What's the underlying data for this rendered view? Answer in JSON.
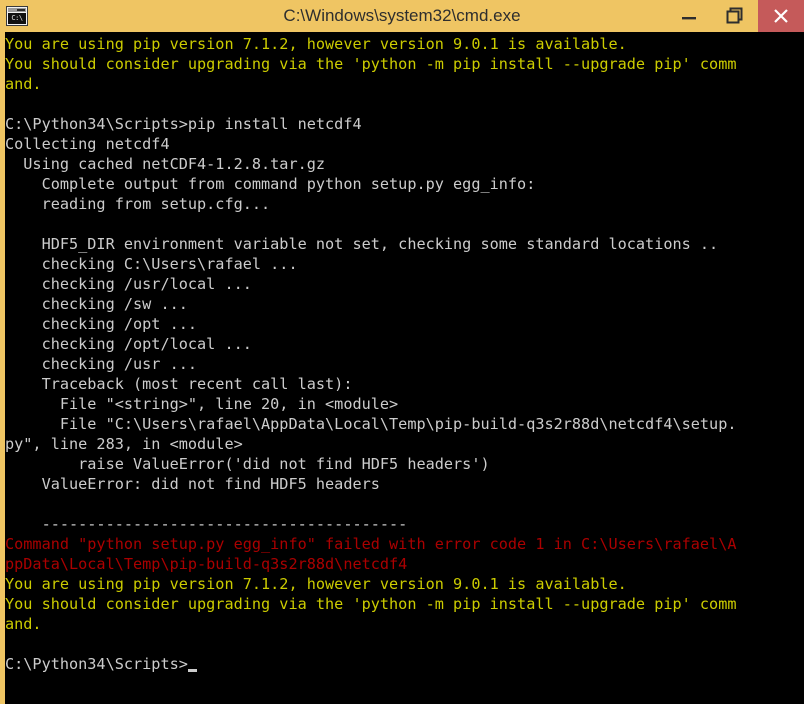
{
  "window": {
    "title": "C:\\Windows\\system32\\cmd.exe",
    "icon_name": "cmd-console-icon",
    "icon_glyph": "C:\\",
    "titlebar_color": "#efc563",
    "background_color": "#000000",
    "controls": {
      "minimize_label": "Minimize",
      "restore_label": "Restore Down",
      "close_label": "Close",
      "close_color": "#c55a5a"
    }
  },
  "console": {
    "colors": {
      "yellow": "#cccc00",
      "white": "#cccccc",
      "red": "#aa0000",
      "background": "#000000",
      "border": "#efc563"
    },
    "prompt": "C:\\Python34\\Scripts>",
    "cursor_visible": true,
    "lines": [
      {
        "color": "yellow",
        "text": "You are using pip version 7.1.2, however version 9.0.1 is available."
      },
      {
        "color": "yellow",
        "text": "You should consider upgrading via the 'python -m pip install --upgrade pip' command."
      },
      {
        "color": "white",
        "text": ""
      },
      {
        "color": "white",
        "text": "C:\\Python34\\Scripts>pip install netcdf4"
      },
      {
        "color": "white",
        "text": "Collecting netcdf4"
      },
      {
        "color": "white",
        "text": "  Using cached netCDF4-1.2.8.tar.gz"
      },
      {
        "color": "white",
        "text": "    Complete output from command python setup.py egg_info:"
      },
      {
        "color": "white",
        "text": "    reading from setup.cfg..."
      },
      {
        "color": "white",
        "text": ""
      },
      {
        "color": "white",
        "text": "    HDF5_DIR environment variable not set, checking some standard locations .."
      },
      {
        "color": "white",
        "text": "    checking C:\\Users\\rafael ..."
      },
      {
        "color": "white",
        "text": "    checking /usr/local ..."
      },
      {
        "color": "white",
        "text": "    checking /sw ..."
      },
      {
        "color": "white",
        "text": "    checking /opt ..."
      },
      {
        "color": "white",
        "text": "    checking /opt/local ..."
      },
      {
        "color": "white",
        "text": "    checking /usr ..."
      },
      {
        "color": "white",
        "text": "    Traceback (most recent call last):"
      },
      {
        "color": "white",
        "text": "      File \"<string>\", line 20, in <module>"
      },
      {
        "color": "white",
        "text": "      File \"C:\\Users\\rafael\\AppData\\Local\\Temp\\pip-build-q3s2r88d\\netcdf4\\setup.py\", line 283, in <module>"
      },
      {
        "color": "white",
        "text": "        raise ValueError('did not find HDF5 headers')"
      },
      {
        "color": "white",
        "text": "    ValueError: did not find HDF5 headers"
      },
      {
        "color": "white",
        "text": ""
      },
      {
        "color": "white",
        "text": "    ----------------------------------------"
      },
      {
        "color": "red",
        "text": "Command \"python setup.py egg_info\" failed with error code 1 in C:\\Users\\rafael\\AppData\\Local\\Temp\\pip-build-q3s2r88d\\netcdf4"
      },
      {
        "color": "yellow",
        "text": "You are using pip version 7.1.2, however version 9.0.1 is available."
      },
      {
        "color": "yellow",
        "text": "You should consider upgrading via the 'python -m pip install --upgrade pip' command."
      },
      {
        "color": "white",
        "text": ""
      },
      {
        "color": "white",
        "text": "C:\\Python34\\Scripts>",
        "cursor": true
      }
    ]
  }
}
